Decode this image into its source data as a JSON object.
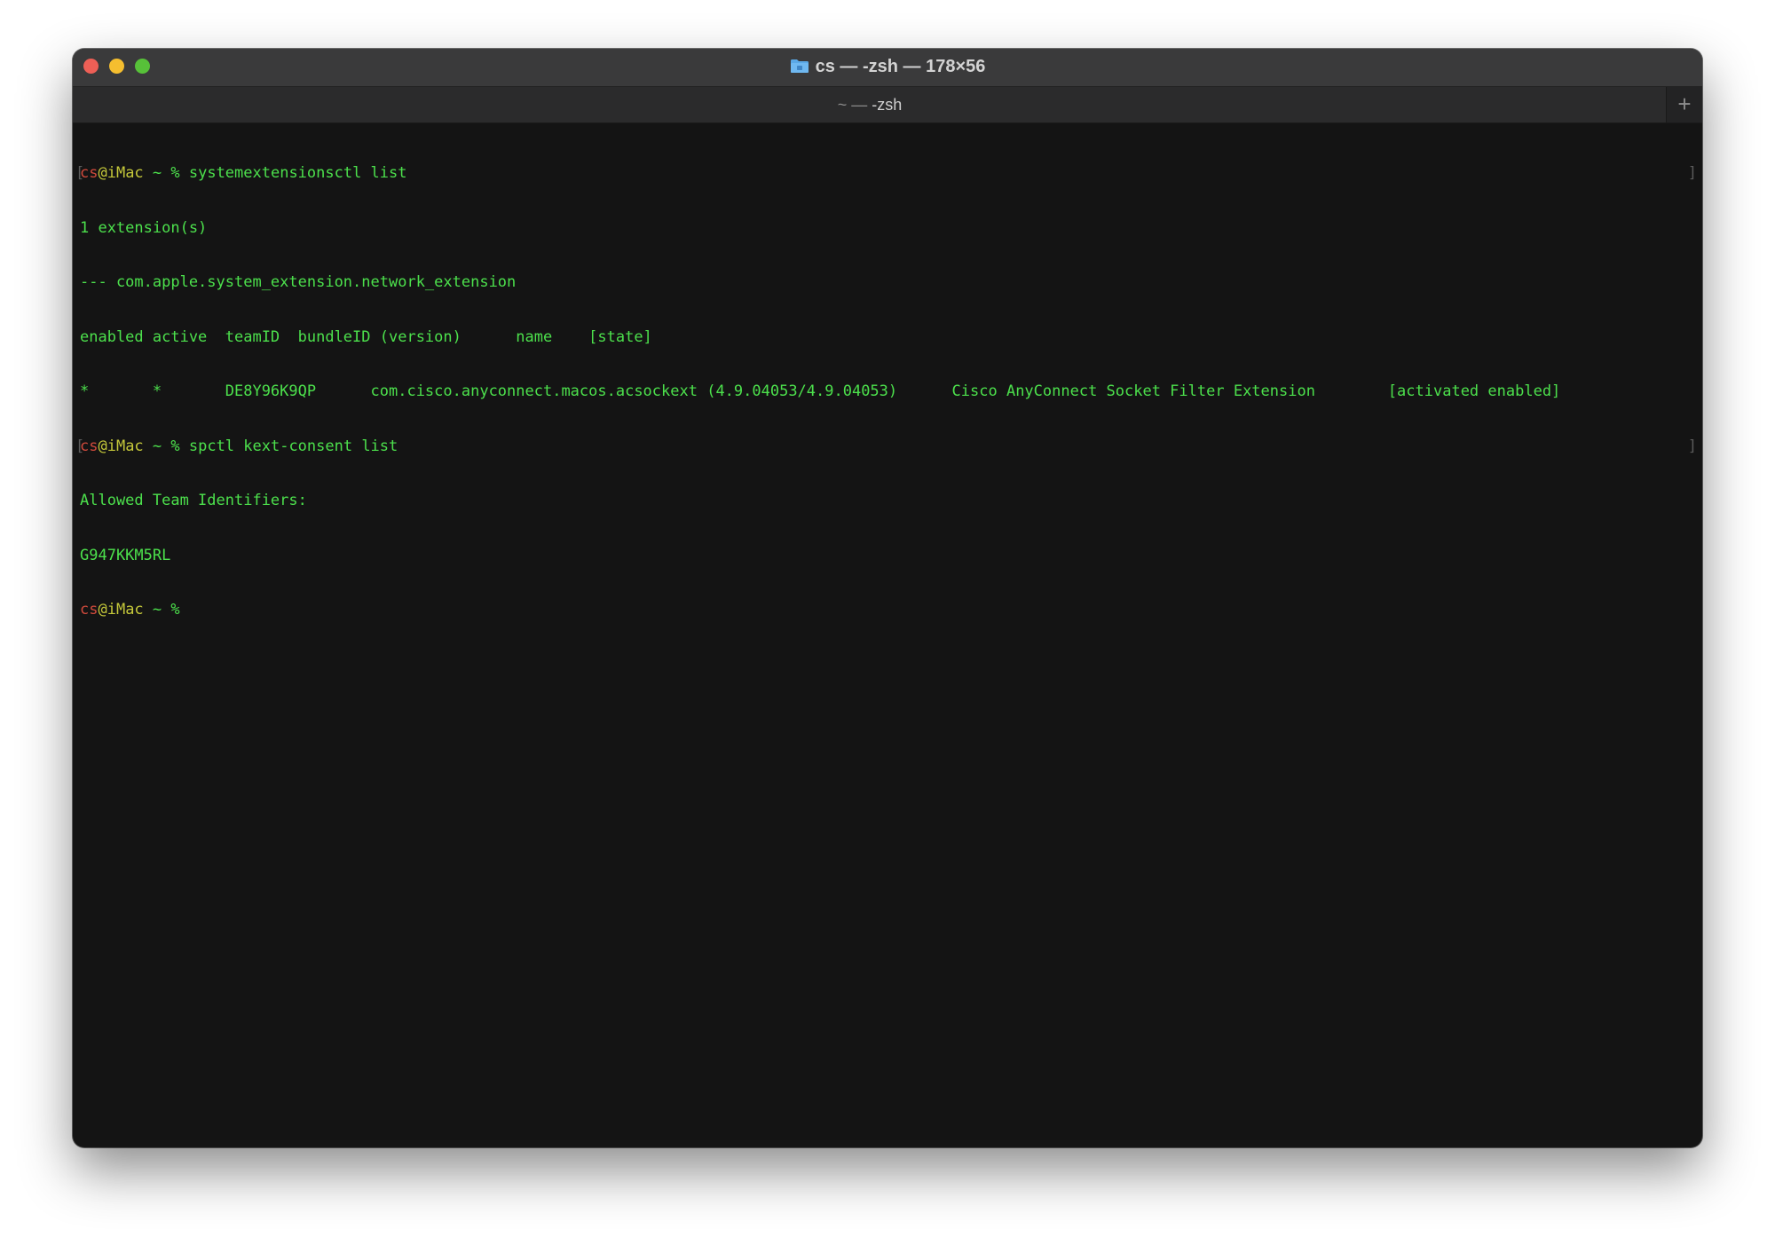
{
  "window": {
    "title": "cs — -zsh — 178×56",
    "tab": {
      "prefix": "~",
      "separator": "—",
      "label": "-zsh"
    },
    "new_tab_symbol": "+"
  },
  "colors": {
    "terminal_bg": "#141414",
    "text_green": "#4ce04c",
    "prompt_user": "#d04a3c",
    "prompt_host": "#c5c83a",
    "close": "#ed5f56",
    "minimize": "#f5be2f",
    "maximize": "#57c139"
  },
  "icons": {
    "title": "folder-icon",
    "traffic_lights": [
      "close-icon",
      "minimize-icon",
      "zoom-icon"
    ],
    "new_tab": "plus-icon"
  },
  "terminal": {
    "prompt": {
      "user": "cs",
      "host": "@iMac",
      "path_symbol": " ~ % "
    },
    "line1_cmd": "systemextensionsctl list",
    "line2": "1 extension(s)",
    "line3": "--- com.apple.system_extension.network_extension",
    "line4": "enabled active  teamID  bundleID (version)      name    [state]",
    "line5": "*       *       DE8Y96K9QP      com.cisco.anyconnect.macos.acsockext (4.9.04053/4.9.04053)      Cisco AnyConnect Socket Filter Extension        [activated enabled]",
    "line6_cmd": "spctl kext-consent list",
    "line7": "Allowed Team Identifiers:",
    "line8": "G947KKM5RL",
    "bracket_left": "[",
    "bracket_right": "]"
  }
}
